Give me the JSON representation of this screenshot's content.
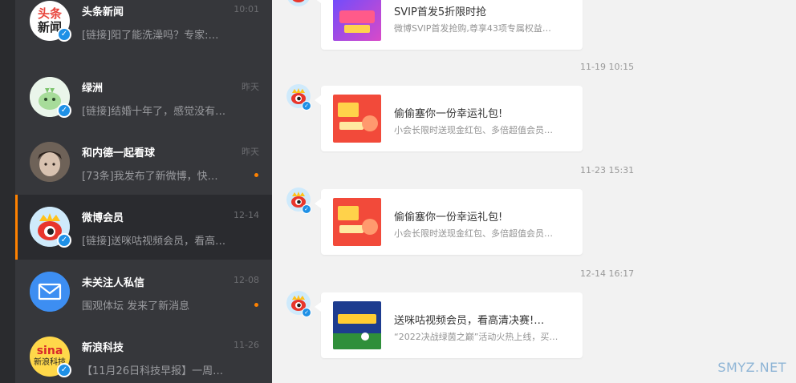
{
  "conversations": [
    {
      "name": "头条新闻",
      "time": "10:01",
      "preview": "[链接]阳了能洗澡吗？专家:…",
      "unread": false,
      "active": false,
      "avatar": "toutiao-avatar",
      "avatar_text": [
        "头条",
        "新闻"
      ]
    },
    {
      "name": "绿洲",
      "time": "昨天",
      "preview": "[链接]结婚十年了，感觉没有…",
      "unread": false,
      "active": false,
      "avatar": "oasis-avatar"
    },
    {
      "name": "和内德一起看球",
      "time": "昨天",
      "preview": "[73条]我发布了新微博，快…",
      "unread": true,
      "active": false,
      "avatar": "person-avatar"
    },
    {
      "name": "微博会员",
      "time": "12-14",
      "preview": "[链接]送咪咕视频会员，看高…",
      "unread": false,
      "active": true,
      "avatar": "weibo-vip-avatar"
    },
    {
      "name": "未关注人私信",
      "time": "12-08",
      "preview": "围观体坛 发来了新消息",
      "unread": true,
      "active": false,
      "avatar": "mail-avatar"
    },
    {
      "name": "新浪科技",
      "time": "11-26",
      "preview": "【11月26日科技早报】一周…",
      "unread": false,
      "active": false,
      "avatar": "sina-tech-avatar",
      "avatar_text": [
        "sina",
        "新浪科技"
      ]
    }
  ],
  "messages": [
    {
      "time": "",
      "title": "SVIP首发5折限时抢",
      "desc": "微博SVIP首发抢购,尊享43项专属权益…",
      "thumb": "svip-promo-image"
    },
    {
      "time": "11-19 10:15",
      "title": "偷偷塞你一份幸运礼包!",
      "desc": "小会长限时送现金红包、多倍超值会员…",
      "thumb": "lucky-gift-image"
    },
    {
      "time": "11-23 15:31",
      "title": "偷偷塞你一份幸运礼包!",
      "desc": "小会长限时送现金红包、多倍超值会员…",
      "thumb": "lucky-gift-image"
    },
    {
      "time": "12-14 16:17",
      "title": "送咪咕视频会员，看高清决赛!…",
      "desc": "“2022决战绿茵之巅”活动火热上线，买…",
      "thumb": "football-promo-image"
    }
  ],
  "watermark": "SMYZ.NET",
  "colors": {
    "accent": "#ff8200",
    "verify": "#1e90e6",
    "sidebar": "#36373b",
    "active": "#2a2b2f"
  }
}
